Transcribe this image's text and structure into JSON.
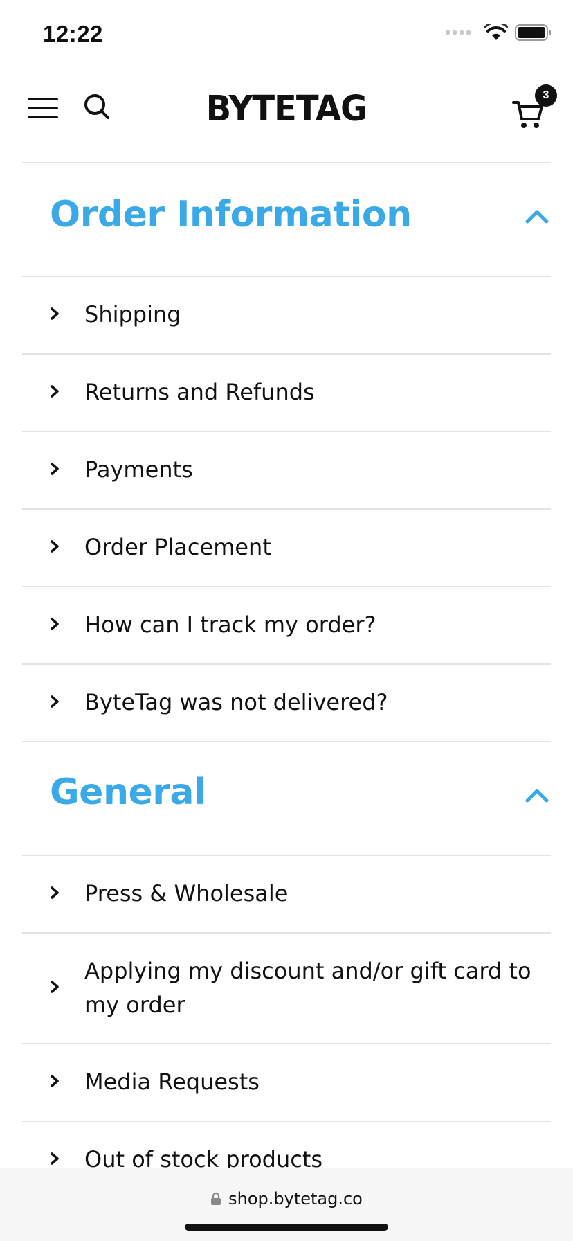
{
  "status_bar": {
    "time": "12:22"
  },
  "header": {
    "logo_text": "BYTETAG",
    "cart_count": "3"
  },
  "sections": [
    {
      "title": "Order Information",
      "expanded": true,
      "items": [
        {
          "label": "Shipping"
        },
        {
          "label": "Returns and Refunds"
        },
        {
          "label": "Payments"
        },
        {
          "label": "Order Placement"
        },
        {
          "label": "How can I track my order?"
        },
        {
          "label": "ByteTag was not delivered?"
        }
      ]
    },
    {
      "title": "General",
      "expanded": true,
      "items": [
        {
          "label": "Press & Wholesale"
        },
        {
          "label": "Applying my discount and/or gift card to my order"
        },
        {
          "label": "Media Requests"
        },
        {
          "label": "Out of stock products"
        }
      ]
    }
  ],
  "browser": {
    "url": "shop.bytetag.co"
  },
  "colors": {
    "accent": "#3aa9e8",
    "text": "#111111",
    "divider": "#e3e3e3"
  }
}
